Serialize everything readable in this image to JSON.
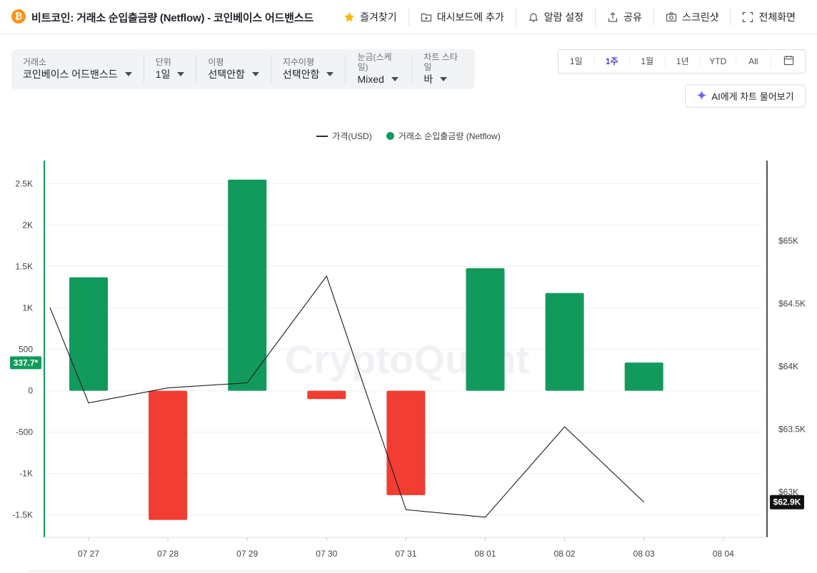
{
  "header": {
    "coin_symbol": "₿",
    "title": "비트코인: 거래소 순입출금량 (Netflow) - 코인베이스 어드밴스드",
    "actions": [
      {
        "label": "즐겨찾기",
        "icon": "star-icon"
      },
      {
        "label": "대시보드에 추가",
        "icon": "folder-plus-icon"
      },
      {
        "label": "알람 설정",
        "icon": "bell-icon"
      },
      {
        "label": "공유",
        "icon": "share-icon"
      },
      {
        "label": "스크린샷",
        "icon": "camera-icon"
      },
      {
        "label": "전체화면",
        "icon": "fullscreen-icon"
      }
    ]
  },
  "filters": [
    {
      "label": "거래소",
      "value": "코인베이스 어드밴스드"
    },
    {
      "label": "단위",
      "value": "1일"
    },
    {
      "label": "이평",
      "value": "선택안함"
    },
    {
      "label": "지수이평",
      "value": "선택안함"
    },
    {
      "label": "눈금(스케일)",
      "value": "Mixed"
    },
    {
      "label": "차트 스타일",
      "value": "바"
    }
  ],
  "periods": [
    "1일",
    "1주",
    "1월",
    "1년",
    "YTD",
    "All"
  ],
  "active_period": "1주",
  "ask_ai_label": "AI에게 차트 물어보기",
  "watermark": "CryptoQuant",
  "colors": {
    "positive": "#129a5c",
    "negative": "#f23d32",
    "accent": "#4c45e0",
    "price_line": "#1a1a1a",
    "icon_star": "#f5b800"
  },
  "chart_data": {
    "type": "bar",
    "legend": [
      {
        "name": "가격(USD)",
        "type": "line"
      },
      {
        "name": "거래소 순입출금량 (Netflow)",
        "type": "bar"
      }
    ],
    "categories": [
      "07 27",
      "07 28",
      "07 29",
      "07 30",
      "07 31",
      "08 01",
      "08 02",
      "08 03",
      "08 04"
    ],
    "series": [
      {
        "name": "거래소 순입출금량 (Netflow)",
        "axis": "left",
        "values": [
          1370,
          -1560,
          2550,
          -100,
          -1260,
          1480,
          1180,
          340,
          null
        ]
      },
      {
        "name": "가격(USD)",
        "axis": "right",
        "x": [
          -0.5,
          0,
          1,
          2,
          3,
          4,
          5,
          6,
          7
        ],
        "values": [
          64470,
          63710,
          63830,
          63870,
          64720,
          62860,
          62800,
          63520,
          62920
        ]
      }
    ],
    "left_axis": {
      "ticks": [
        2500,
        2000,
        1500,
        1000,
        500,
        0,
        -500,
        -1000,
        -1500
      ],
      "tick_labels": [
        "2.5K",
        "2K",
        "1.5K",
        "1K",
        "500",
        "0",
        "-500",
        "-1K",
        "-1.5K"
      ],
      "ylim": [
        -1770,
        2780
      ]
    },
    "right_axis": {
      "ticks": [
        65000,
        64500,
        64000,
        63500,
        63000
      ],
      "tick_labels": [
        "$65K",
        "$64.5K",
        "$64K",
        "$63.5K",
        "$63K"
      ],
      "ylim": [
        62640,
        65640
      ]
    },
    "current_value_label": "337.7*",
    "current_value": 337.7,
    "current_price_label": "$62.9K",
    "current_price": 62920,
    "grid": true
  }
}
